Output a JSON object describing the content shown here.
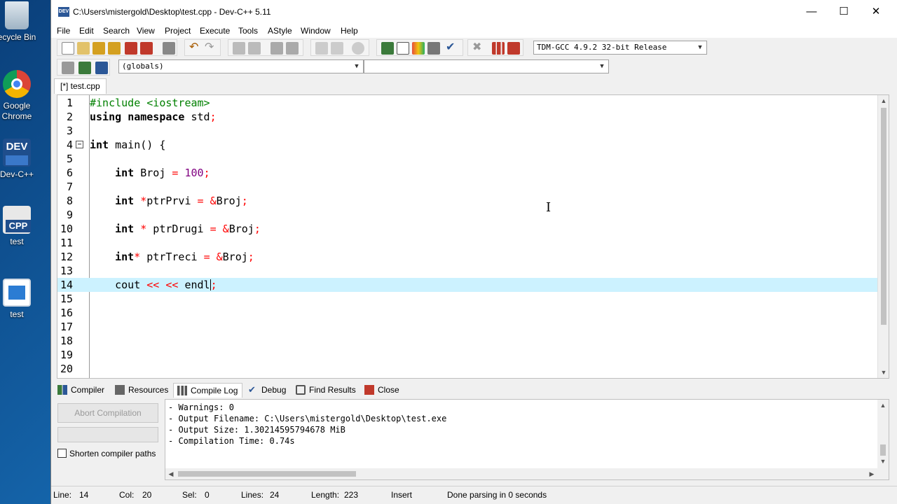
{
  "desktop": {
    "icons": [
      {
        "label": "ecycle Bin",
        "icon": "recycle-bin-icon"
      },
      {
        "label": "Google Chrome",
        "icon": "chrome-icon"
      },
      {
        "label": "Dev-C++",
        "icon": "devcpp-icon"
      },
      {
        "label": "test",
        "icon": "cpp-file-icon"
      },
      {
        "label": "test",
        "icon": "exe-file-icon"
      }
    ]
  },
  "window": {
    "title": "C:\\Users\\mistergold\\Desktop\\test.cpp - Dev-C++ 5.11",
    "app_icon_text": "DEV"
  },
  "menu": [
    "File",
    "Edit",
    "Search",
    "View",
    "Project",
    "Execute",
    "Tools",
    "AStyle",
    "Window",
    "Help"
  ],
  "toolbar": {
    "compiler_select": "TDM-GCC 4.9.2 32-bit Release",
    "scope_select": "(globals)",
    "member_select": ""
  },
  "tabs": {
    "file_tab": "[*] test.cpp"
  },
  "editor": {
    "active_line": 14,
    "lines": [
      "1",
      "2",
      "3",
      "4",
      "5",
      "6",
      "7",
      "8",
      "9",
      "10",
      "11",
      "12",
      "13",
      "14",
      "15",
      "16",
      "17",
      "18",
      "19",
      "20"
    ],
    "code": {
      "l1_pp": "#include <iostream>",
      "l2_kw1": "using",
      "l2_kw2": "namespace",
      "l2_rest": " std",
      "semi": ";",
      "int": "int",
      "l4_rest": " main() {",
      "l6_var": " Broj ",
      "eq": "=",
      "l6_num": "100",
      "l8_ptr": "*",
      "l8_var": "ptrPrvi ",
      "amp": "&",
      "broj": "Broj",
      "l10_var": " ptrDrugi ",
      "l12_var": " ptrTreci ",
      "cout": "cout ",
      "shl": "<<",
      "endl": "endl"
    }
  },
  "panel": {
    "tabs": [
      "Compiler",
      "Resources",
      "Compile Log",
      "Debug",
      "Find Results",
      "Close"
    ],
    "active_tab": "Compile Log",
    "abort_label": "Abort Compilation",
    "shorten_label": "Shorten compiler paths",
    "log": [
      "- Warnings: 0",
      "- Output Filename: C:\\Users\\mistergold\\Desktop\\test.exe",
      "- Output Size: 1.30214595794678 MiB",
      "- Compilation Time: 0.74s"
    ]
  },
  "status": {
    "line_label": "Line:",
    "line_value": "14",
    "col_label": "Col:",
    "col_value": "20",
    "sel_label": "Sel:",
    "sel_value": "0",
    "lines_label": "Lines:",
    "lines_value": "24",
    "length_label": "Length:",
    "length_value": "223",
    "mode": "Insert",
    "message": "Done parsing in 0 seconds"
  }
}
